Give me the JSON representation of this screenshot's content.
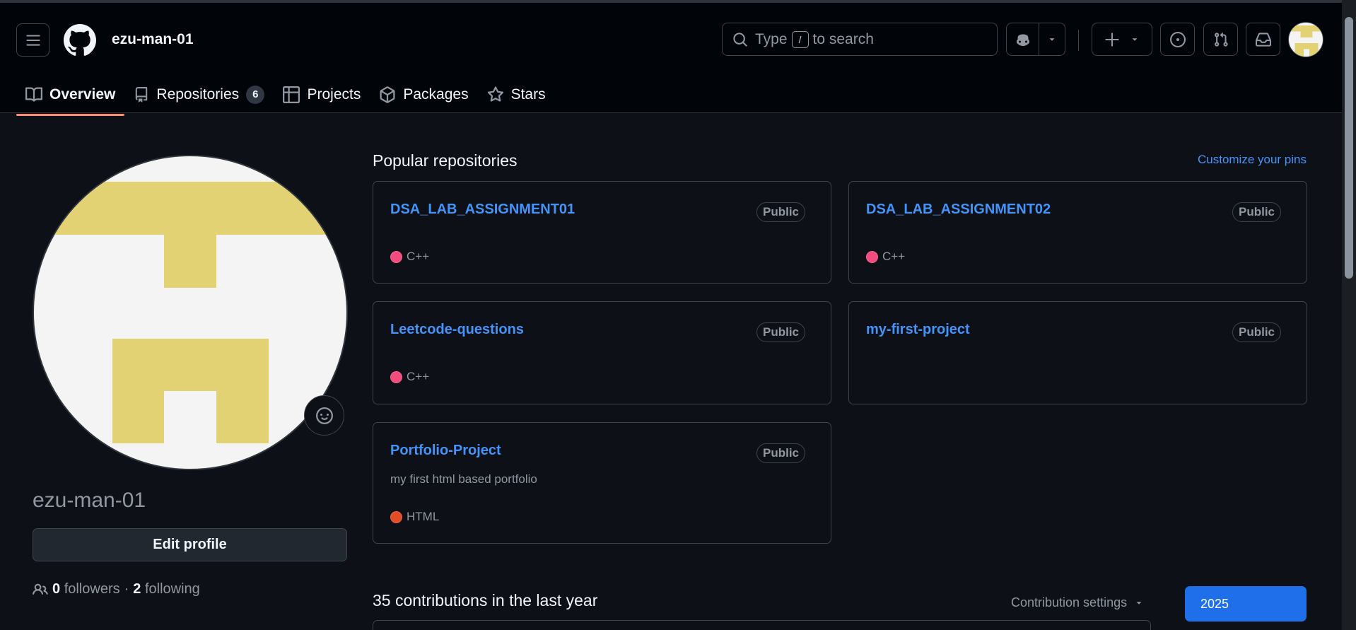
{
  "header": {
    "username": "ezu-man-01",
    "search": {
      "prefix": "Type",
      "key": "/",
      "suffix": "to search"
    }
  },
  "tabs": [
    {
      "label": "Overview",
      "icon": "book-icon",
      "active": true
    },
    {
      "label": "Repositories",
      "icon": "repo-icon",
      "count": "6"
    },
    {
      "label": "Projects",
      "icon": "table-icon"
    },
    {
      "label": "Packages",
      "icon": "package-icon"
    },
    {
      "label": "Stars",
      "icon": "star-icon"
    }
  ],
  "profile": {
    "name": "ezu-man-01",
    "edit_label": "Edit profile",
    "followers_count": "0",
    "followers_label": "followers",
    "separator": "·",
    "following_count": "2",
    "following_label": "following"
  },
  "popular": {
    "title": "Popular repositories",
    "customize": "Customize your pins",
    "repos": [
      {
        "name": "DSA_LAB_ASSIGNMENT01",
        "visibility": "Public",
        "language": "C++",
        "lang_color": "#f34b7d"
      },
      {
        "name": "DSA_LAB_ASSIGNMENT02",
        "visibility": "Public",
        "language": "C++",
        "lang_color": "#f34b7d"
      },
      {
        "name": "Leetcode-questions",
        "visibility": "Public",
        "language": "C++",
        "lang_color": "#f34b7d"
      },
      {
        "name": "my-first-project",
        "visibility": "Public"
      },
      {
        "name": "Portfolio-Project",
        "visibility": "Public",
        "description": "my first html based portfolio",
        "language": "HTML",
        "lang_color": "#e34c26"
      }
    ]
  },
  "contributions": {
    "title": "35 contributions in the last year",
    "settings": "Contribution settings",
    "year": "2025"
  },
  "colors": {
    "link": "#4493f8",
    "accent_tab": "#fd8c73",
    "year_button": "#1f6feb",
    "avatar_fg": "#e3d274",
    "avatar_bg": "#f4f4f4"
  }
}
